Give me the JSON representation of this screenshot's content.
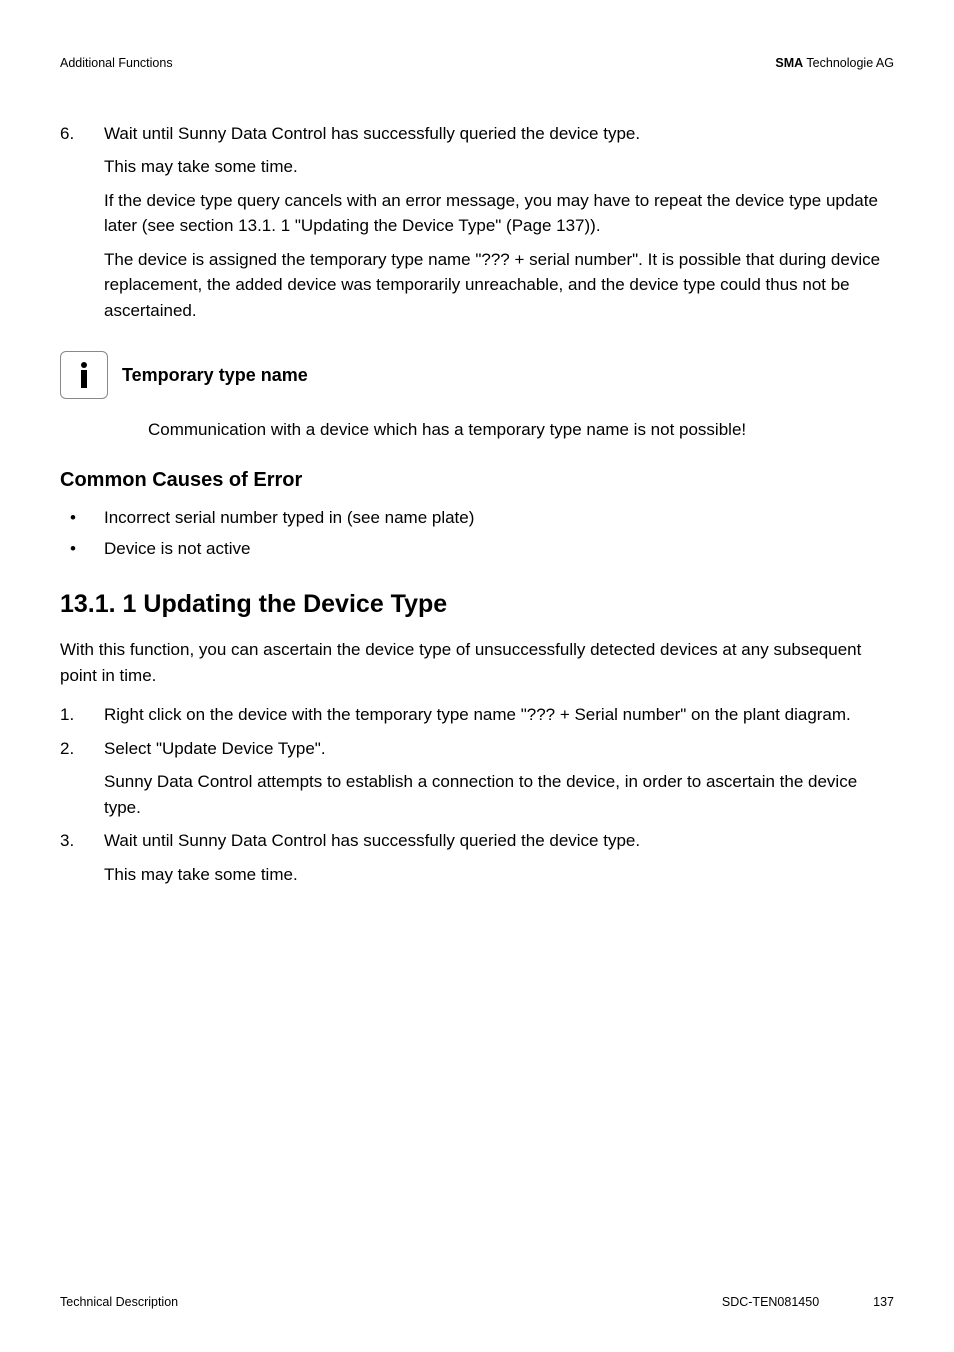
{
  "header": {
    "left": "Additional Functions",
    "right_bold": "SMA",
    "right_rest": " Technologie AG"
  },
  "step6": {
    "num": "6.",
    "line1": "Wait until Sunny Data Control has successfully queried the device type.",
    "line2": "This may take some time.",
    "line3": "If the device type query cancels with an error message, you may have to repeat the device type update later (see section 13.1. 1 \"Updating the Device Type\" (Page 137)).",
    "line4": "The device is assigned the temporary type name \"??? + serial number\". It is possible that during device replacement, the added device was temporarily unreachable, and the device type could thus not be ascertained."
  },
  "info": {
    "title": "Temporary type name",
    "body": "Communication with a device which has a temporary type name is not possible!"
  },
  "causes": {
    "heading": "Common Causes of Error",
    "items": [
      "Incorrect serial number typed in (see name plate)",
      "Device is not active"
    ]
  },
  "section": {
    "heading": "13.1. 1 Updating the Device Type",
    "intro": "With this function, you can ascertain the device type of unsuccessfully detected devices at any subsequent point in time.",
    "steps": [
      {
        "num": "1.",
        "text": "Right click on the device with the temporary type name \"??? + Serial number\" on the plant diagram."
      },
      {
        "num": "2.",
        "text": "Select \"Update Device Type\".",
        "sub": "Sunny Data Control attempts to establish a connection to the device, in order to ascertain the device type."
      },
      {
        "num": "3.",
        "text": "Wait until Sunny Data Control has successfully queried the device type.",
        "sub": "This may take some time."
      }
    ]
  },
  "footer": {
    "left": "Technical Description",
    "doc": "SDC-TEN081450",
    "page": "137"
  }
}
